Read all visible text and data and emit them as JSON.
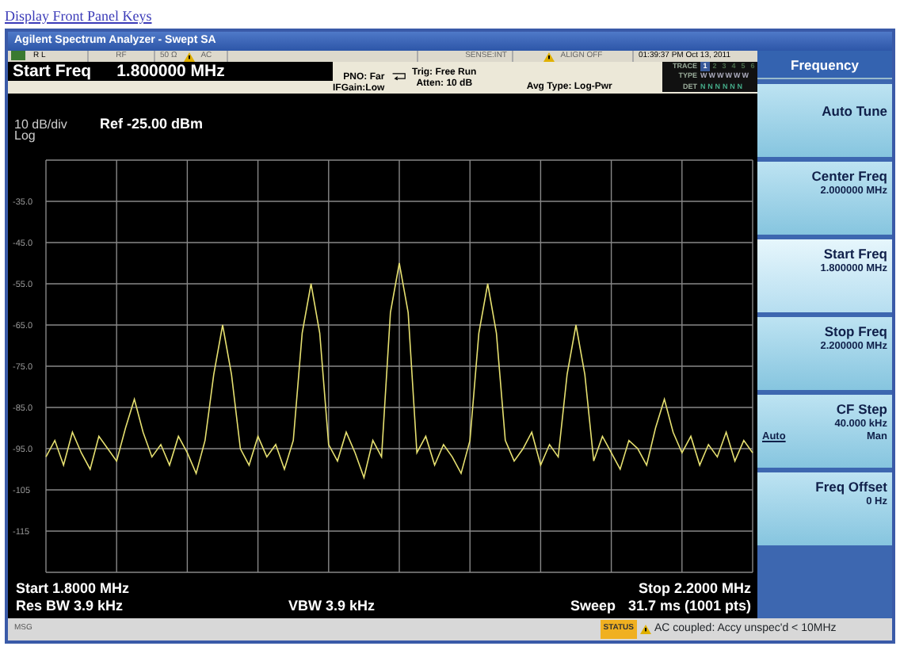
{
  "link": "Display Front Panel Keys",
  "window": {
    "title": "Agilent Spectrum Analyzer - Swept SA"
  },
  "status_row": {
    "rl": "R L",
    "rf": "RF",
    "input": "50 Ω",
    "coupling": "AC",
    "sense": "SENSE:INT",
    "align": "ALIGN OFF",
    "datetime": "01:39:37 PM Oct 13, 2011"
  },
  "active_function": {
    "label": "Start Freq",
    "value": "1.800000 MHz"
  },
  "settings": {
    "pno": "PNO: Far",
    "ifgain": "IFGain:Low",
    "trig": "Trig: Free Run",
    "atten": "Atten: 10 dB",
    "avg_type": "Avg Type: Log-Pwr"
  },
  "trace_panel": {
    "trace_label": "TRACE",
    "traces": [
      {
        "label": "1",
        "selected": true
      },
      {
        "label": "2",
        "selected": false
      },
      {
        "label": "3",
        "selected": false
      },
      {
        "label": "4",
        "selected": false
      },
      {
        "label": "5",
        "selected": false
      },
      {
        "label": "6",
        "selected": false
      }
    ],
    "type_label": "TYPE",
    "type_value": "WWWWWW",
    "det_label": "DET",
    "det_value": "NNNNNN"
  },
  "display": {
    "scale": "10 dB/div",
    "scale_type": "Log",
    "ref": "Ref -25.00 dBm",
    "chart_data": {
      "type": "line",
      "grid": true,
      "ylim": [
        -125,
        -25
      ],
      "yticks": [
        {
          "value": -35,
          "label": "-35.0"
        },
        {
          "value": -45,
          "label": "-45.0"
        },
        {
          "value": -55,
          "label": "-55.0"
        },
        {
          "value": -65,
          "label": "-65.0"
        },
        {
          "value": -75,
          "label": "-75.0"
        },
        {
          "value": -85,
          "label": "-85.0"
        },
        {
          "value": -95,
          "label": "-95.0"
        },
        {
          "value": -105,
          "label": "-105"
        },
        {
          "value": -115,
          "label": "-115"
        }
      ],
      "categories": [
        null,
        null,
        null,
        null,
        null,
        null,
        null,
        null,
        null,
        null,
        null,
        null,
        null,
        null,
        null,
        null,
        null,
        null,
        null,
        null,
        null,
        null,
        null,
        null,
        null,
        null,
        null,
        null,
        null,
        null,
        null,
        null,
        null,
        null,
        null,
        null,
        null,
        null,
        null,
        null,
        null,
        null,
        null,
        null,
        null,
        null,
        null,
        null,
        null,
        null,
        null,
        null,
        null,
        null,
        null,
        null,
        null,
        null,
        null,
        null,
        null,
        null,
        null,
        null,
        null,
        null,
        null,
        null,
        null,
        null,
        null,
        null,
        null,
        null,
        null,
        null,
        null,
        null,
        null,
        null,
        null
      ],
      "series": [
        {
          "color": "#e6e070",
          "values": [
            -97,
            -93,
            -99,
            -91,
            -96,
            -100,
            -92,
            -95,
            -98,
            -90,
            -83,
            -91,
            -97,
            -94,
            -99,
            -92,
            -96,
            -101,
            -93,
            -77,
            -65,
            -77,
            -95,
            -99,
            -92,
            -97,
            -94,
            -100,
            -93,
            -67,
            -55,
            -67,
            -94,
            -98,
            -91,
            -96,
            -102,
            -93,
            -97,
            -62,
            -50,
            -62,
            -96,
            -92,
            -99,
            -94,
            -97,
            -101,
            -93,
            -67,
            -55,
            -67,
            -93,
            -98,
            -95,
            -91,
            -99,
            -94,
            -97,
            -77,
            -65,
            -77,
            -98,
            -92,
            -96,
            -100,
            -93,
            -95,
            -99,
            -90,
            -83,
            -91,
            -96,
            -92,
            -99,
            -94,
            -97,
            -91,
            -98,
            -93,
            -96
          ]
        }
      ]
    }
  },
  "footer": {
    "start": "Start 1.8000 MHz",
    "stop": "Stop 2.2000 MHz",
    "res_bw": "Res BW 3.9 kHz",
    "vbw": "VBW 3.9 kHz",
    "sweep_label": "Sweep",
    "sweep": "31.7 ms (1001 pts)"
  },
  "softkeys": {
    "title": "Frequency",
    "items": [
      {
        "label": "Auto Tune",
        "selected": false
      },
      {
        "label": "Center Freq",
        "value": "2.000000 MHz",
        "selected": false
      },
      {
        "label": "Start Freq",
        "value": "1.800000 MHz",
        "selected": true
      },
      {
        "label": "Stop Freq",
        "value": "2.200000 MHz",
        "selected": false
      },
      {
        "label": "CF Step",
        "value": "40.000 kHz",
        "options": [
          {
            "label": "Auto",
            "selected": true
          },
          {
            "label": "Man",
            "selected": false
          }
        ],
        "selected": false
      },
      {
        "label": "Freq Offset",
        "value": "0 Hz",
        "selected": false
      }
    ]
  },
  "status_bar": {
    "msg": "MSG",
    "status": "STATUS",
    "message": "AC coupled: Accy unspec'd < 10MHz"
  }
}
